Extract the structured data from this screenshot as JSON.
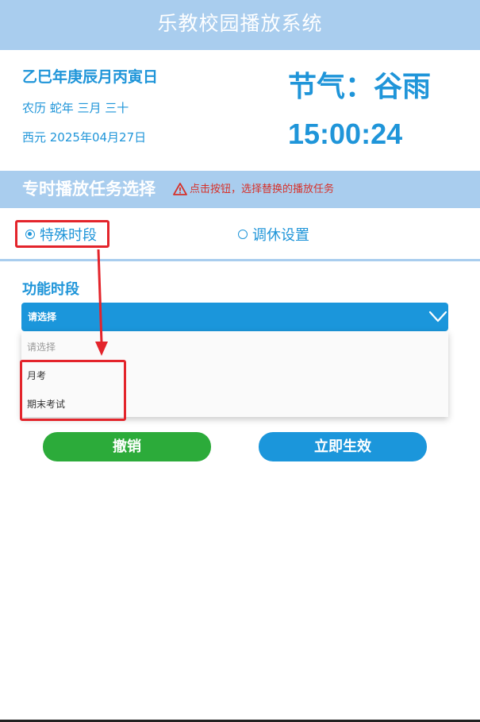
{
  "header": {
    "title": "乐教校园播放系统"
  },
  "date_panel": {
    "ganzhi": "乙巳年庚辰月丙寅日",
    "lunar": "农历 蛇年 三月 三十",
    "gregorian": "西元 2025年04月27日",
    "solar_term": "节气：谷雨",
    "clock": "15:00:24"
  },
  "section": {
    "title": "专时播放任务选择",
    "warning": "点击按钮，选择替换的播放任务",
    "warning_icon": "warning-triangle-icon"
  },
  "radio_options": [
    {
      "label": "特殊时段",
      "checked": true
    },
    {
      "label": "调休设置",
      "checked": false
    }
  ],
  "function_period": {
    "label": "功能时段",
    "selected": "请选择",
    "options": [
      "请选择",
      "月考",
      "期末考试"
    ]
  },
  "buttons": {
    "cancel": "撤销",
    "apply": "立即生效"
  },
  "colors": {
    "accent": "#1f95d9",
    "header_bg": "#a9cdee",
    "cancel_green": "#2cab3a",
    "annotation_red": "#e3242b"
  }
}
